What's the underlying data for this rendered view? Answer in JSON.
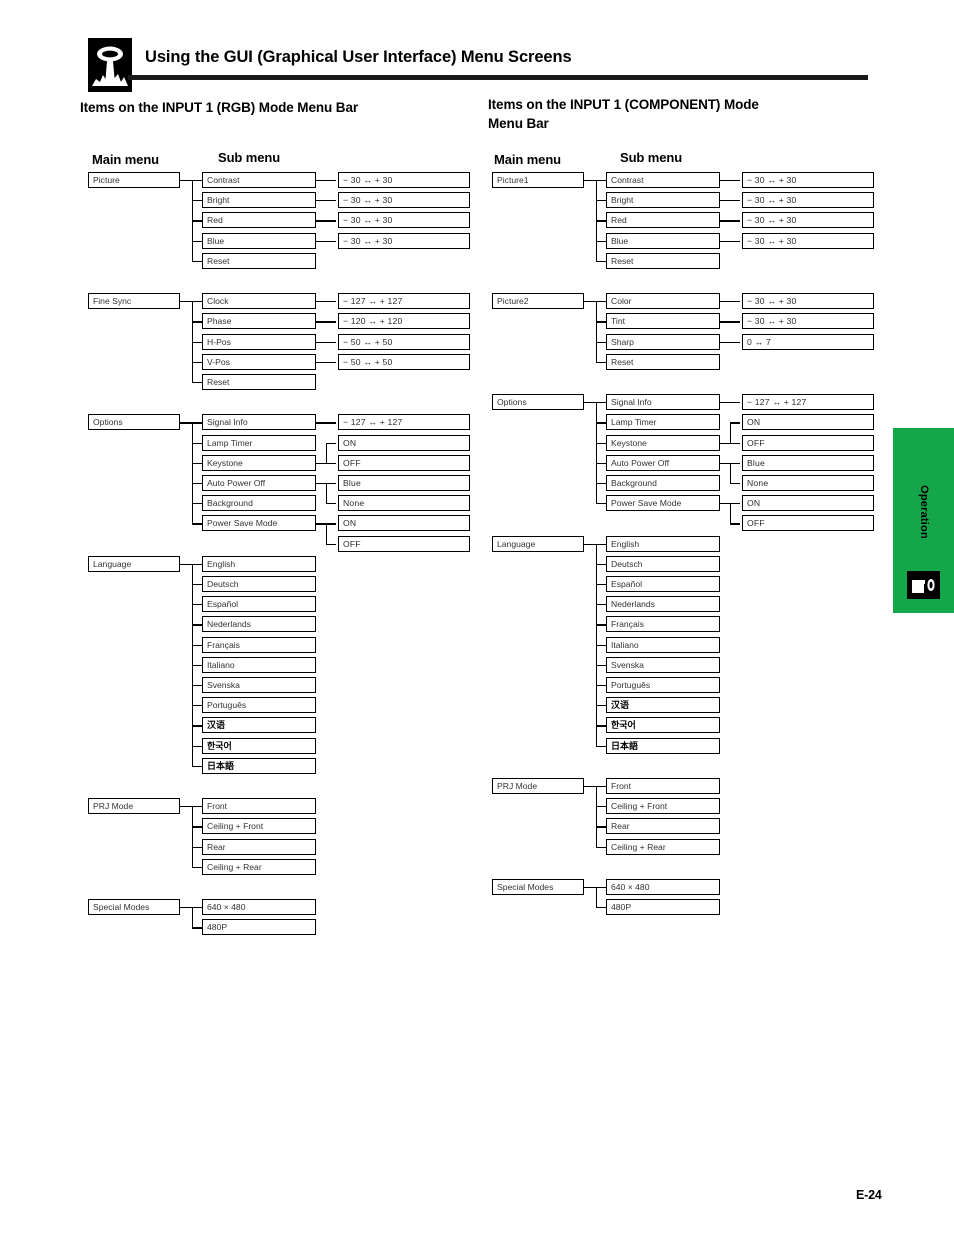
{
  "header": {
    "icon": "projector-icon",
    "title": "Using the GUI (Graphical User Interface) Menu Screens"
  },
  "sections": [
    {
      "id": "rgb",
      "heading": "Items on the INPUT 1 (RGB) Mode Menu Bar",
      "main_menu_label": "Main menu",
      "sub_menu_label": "Sub menu"
    },
    {
      "id": "component",
      "heading": "Items on the INPUT 1 (COMPONENT) Mode Menu Bar",
      "main_menu_label": "Main menu",
      "sub_menu_label": "Sub menu"
    }
  ],
  "rgb_tree": {
    "main": [
      "Picture",
      "Fine Sync",
      "Options",
      "Language",
      "PRJ Mode",
      "Special Modes"
    ],
    "groups": [
      {
        "main": "Picture",
        "sub": [
          "Contrast",
          "Bright",
          "Red",
          "Blue",
          "Reset"
        ],
        "values": [
          "− 30 ↔ + 30",
          "− 30 ↔ + 30",
          "− 30 ↔ + 30",
          "− 30 ↔ + 30"
        ]
      },
      {
        "main": "Fine Sync",
        "sub": [
          "Clock",
          "Phase",
          "H-Pos",
          "V-Pos",
          "Reset"
        ],
        "values": [
          "− 127 ↔ + 127",
          "− 120 ↔ + 120",
          "− 50 ↔ + 50",
          "− 50 ↔ + 50"
        ]
      },
      {
        "main": "Options",
        "sub": [
          "Signal Info",
          "Lamp Timer",
          "Keystone",
          "Auto Power Off",
          "Background",
          "Power Save Mode"
        ],
        "values": [
          "− 127 ↔ + 127",
          "ON",
          "OFF",
          "Blue",
          "None",
          "ON",
          "OFF"
        ]
      },
      {
        "main": "Language",
        "sub": [
          "English",
          "Deutsch",
          "Español",
          "Nederlands",
          "Français",
          "Italiano",
          "Svenska",
          "Português",
          "汉语",
          "한국어",
          "日本語"
        ]
      },
      {
        "main": "PRJ Mode",
        "sub": [
          "Front",
          "Ceiling + Front",
          "Rear",
          "Ceiling + Rear"
        ]
      },
      {
        "main": "Special Modes",
        "sub": [
          "640 × 480",
          "480P"
        ]
      }
    ]
  },
  "component_tree": {
    "main": [
      "Picture1",
      "Picture2",
      "Options",
      "Language",
      "PRJ Mode",
      "Special Modes"
    ],
    "groups": [
      {
        "main": "Picture1",
        "sub": [
          "Contrast",
          "Bright",
          "Red",
          "Blue",
          "Reset"
        ],
        "values": [
          "− 30 ↔ + 30",
          "− 30 ↔ + 30",
          "− 30 ↔ + 30",
          "− 30 ↔ + 30"
        ]
      },
      {
        "main": "Picture2",
        "sub": [
          "Color",
          "Tint",
          "Sharp",
          "Reset"
        ],
        "values": [
          "− 30 ↔ + 30",
          "− 30 ↔ + 30",
          "0 ↔ 7"
        ]
      },
      {
        "main": "Options",
        "sub": [
          "Signal Info",
          "Lamp Timer",
          "Keystone",
          "Auto Power Off",
          "Background",
          "Power Save Mode"
        ],
        "values": [
          "− 127 ↔ + 127",
          "ON",
          "OFF",
          "Blue",
          "None",
          "ON",
          "OFF"
        ]
      },
      {
        "main": "Language",
        "sub": [
          "English",
          "Deutsch",
          "Español",
          "Nederlands",
          "Français",
          "Italiano",
          "Svenska",
          "Português",
          "汉语",
          "한국어",
          "日本語"
        ]
      },
      {
        "main": "PRJ Mode",
        "sub": [
          "Front",
          "Ceiling + Front",
          "Rear",
          "Ceiling + Rear"
        ]
      },
      {
        "main": "Special Modes",
        "sub": [
          "640 × 480",
          "480P"
        ]
      }
    ]
  },
  "side_tab": {
    "label": "Operation",
    "color": "#16a64a",
    "icon": "projector-icon"
  },
  "footer": {
    "page_number": "E-24"
  }
}
